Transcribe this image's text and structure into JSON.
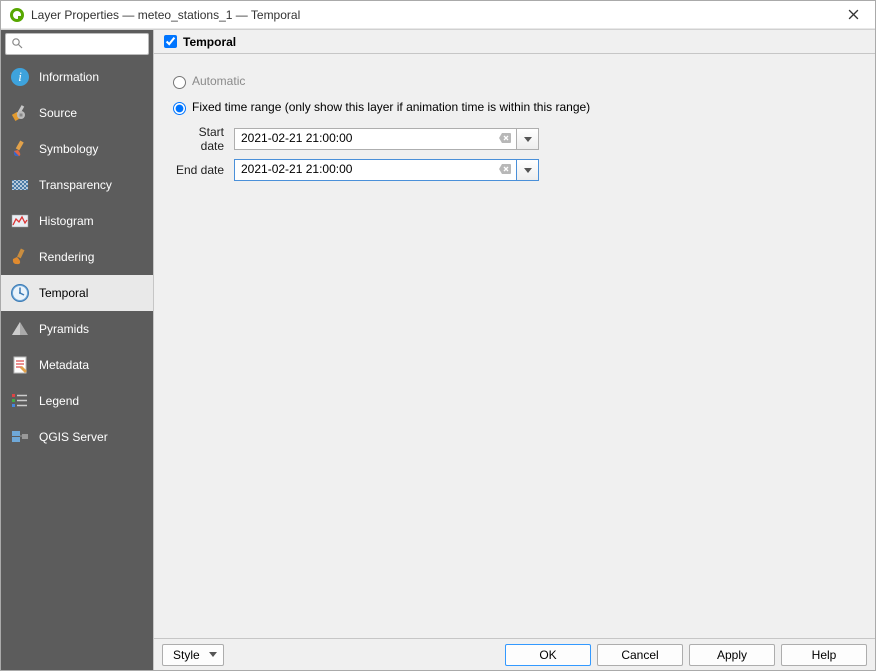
{
  "window": {
    "title": "Layer Properties — meteo_stations_1 — Temporal"
  },
  "search": {
    "placeholder": ""
  },
  "sidebar": {
    "items": [
      {
        "label": "Information"
      },
      {
        "label": "Source"
      },
      {
        "label": "Symbology"
      },
      {
        "label": "Transparency"
      },
      {
        "label": "Histogram"
      },
      {
        "label": "Rendering"
      },
      {
        "label": "Temporal"
      },
      {
        "label": "Pyramids"
      },
      {
        "label": "Metadata"
      },
      {
        "label": "Legend"
      },
      {
        "label": "QGIS Server"
      }
    ],
    "selected": "Temporal"
  },
  "temporal": {
    "header_label": "Temporal",
    "header_checked": true,
    "radio_automatic": "Automatic",
    "radio_fixed": "Fixed time range (only show this layer if animation time is within this range)",
    "selected_mode": "fixed",
    "start_label": "Start date",
    "start_value": "2021-02-21 21:00:00",
    "end_label": "End date",
    "end_value": "2021-02-21 21:00:00"
  },
  "buttons": {
    "style": "Style",
    "ok": "OK",
    "cancel": "Cancel",
    "apply": "Apply",
    "help": "Help"
  }
}
